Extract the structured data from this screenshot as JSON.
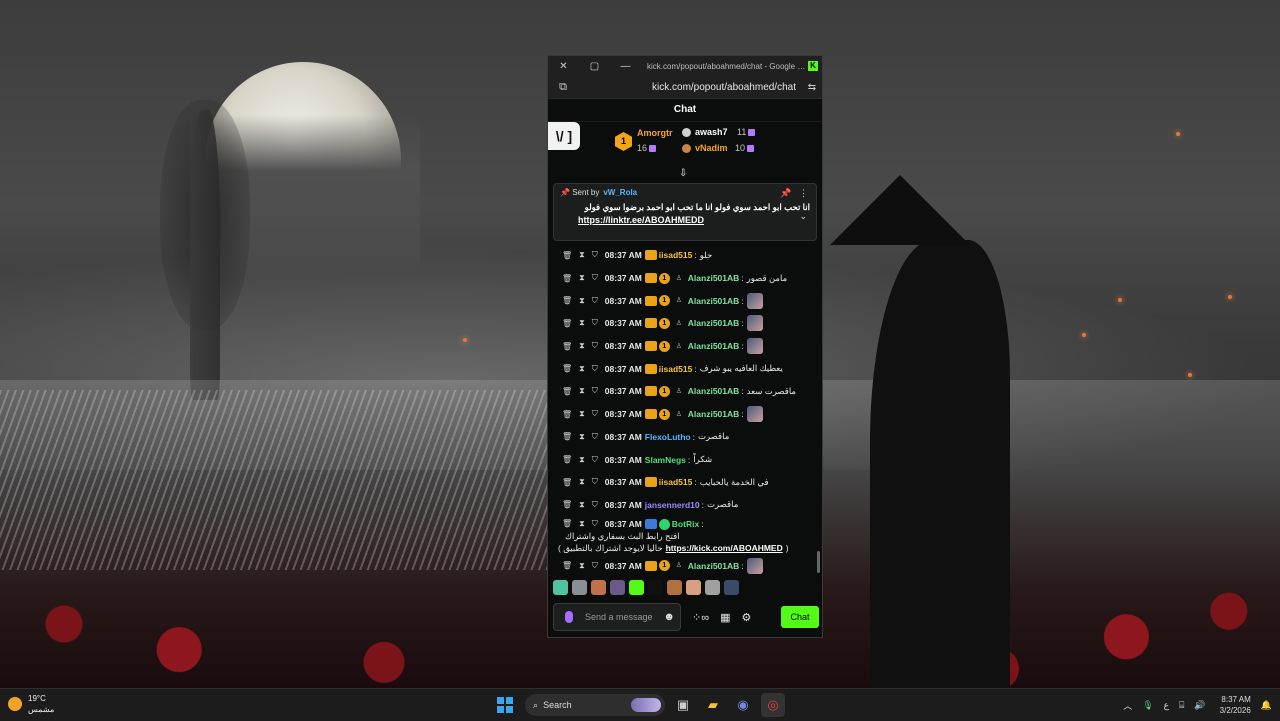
{
  "window": {
    "title": "kick.com/popout/aboahmed/chat - Google C...",
    "url": "kick.com/popout/aboahmed/chat",
    "header": "Chat"
  },
  "leaderboard": {
    "logo_text": "\\/ ]",
    "first": {
      "rank": "1",
      "name": "Amorgtr",
      "count": "16"
    },
    "second": {
      "name": "awash7",
      "count": "11"
    },
    "third": {
      "name": "vNadim",
      "count": "10"
    }
  },
  "pinned": {
    "sent_by_label": "Sent by",
    "sender": "vW_Rola",
    "text": "انا تحب ابو احمد سوي فولو انا ما تحب ابو احمد برضوا سوي فولو",
    "link": "https://linktr.ee/ABOAHMEDD"
  },
  "messages": [
    {
      "time": "08:37 AM",
      "user": "iisad515",
      "color": "#f5c542",
      "crown": true,
      "badge1": false,
      "text": "حلو",
      "emote": false
    },
    {
      "time": "08:37 AM",
      "user": "Alanzi501AB",
      "color": "#7de3a0",
      "crown": true,
      "badge1": true,
      "text": "مامن قصور",
      "emote": false
    },
    {
      "time": "08:37 AM",
      "user": "Alanzi501AB",
      "color": "#7de3a0",
      "crown": true,
      "badge1": true,
      "text": "",
      "emote": true
    },
    {
      "time": "08:37 AM",
      "user": "Alanzi501AB",
      "color": "#7de3a0",
      "crown": true,
      "badge1": true,
      "text": "",
      "emote": true
    },
    {
      "time": "08:37 AM",
      "user": "Alanzi501AB",
      "color": "#7de3a0",
      "crown": true,
      "badge1": true,
      "text": "",
      "emote": true
    },
    {
      "time": "08:37 AM",
      "user": "iisad515",
      "color": "#f5c542",
      "crown": true,
      "badge1": false,
      "text": "يعطيك العافيه يبو شرف",
      "emote": false
    },
    {
      "time": "08:37 AM",
      "user": "Alanzi501AB",
      "color": "#7de3a0",
      "crown": true,
      "badge1": true,
      "text": "ماقصرت سعد",
      "emote": false
    },
    {
      "time": "08:37 AM",
      "user": "Alanzi501AB",
      "color": "#7de3a0",
      "crown": true,
      "badge1": true,
      "text": "",
      "emote": true
    },
    {
      "time": "08:37 AM",
      "user": "FlexoLutho",
      "color": "#5ab7ff",
      "crown": false,
      "badge1": false,
      "text": "ماقصرت",
      "emote": false
    },
    {
      "time": "08:37 AM",
      "user": "SlamNegs",
      "color": "#53e07a",
      "crown": false,
      "badge1": false,
      "text": "شكراً",
      "emote": false
    },
    {
      "time": "08:37 AM",
      "user": "iisad515",
      "color": "#f5c542",
      "crown": true,
      "badge1": false,
      "text": "في الخدمة يالحبايب",
      "emote": false
    },
    {
      "time": "08:37 AM",
      "user": "jansennerd10",
      "color": "#9a8cff",
      "crown": false,
      "badge1": false,
      "text": "ماقصرت",
      "emote": false
    }
  ],
  "bot_message": {
    "time": "08:37 AM",
    "user": "BotRix",
    "text": "افتح رابط البث بسفاري واشتراك",
    "line2_pre": ")",
    "link": "https://kick.com/ABOAHMED",
    "line2_post": "( حاليا لايوجد اشتراك بالتطبيق"
  },
  "last_message": {
    "time": "08:37 AM",
    "user": "Alanzi501AB",
    "color": "#7de3a0"
  },
  "input": {
    "placeholder": "Send a message",
    "send_label": "Chat"
  },
  "taskbar": {
    "temperature": "19°C",
    "weather": "مشمس",
    "search_label": "Search",
    "clock_time": "8:37 AM",
    "clock_date": "3/2/2026",
    "lang": "ع"
  },
  "colors": {
    "kick_green": "#53fc18",
    "crown_gold": "#e8a317"
  }
}
